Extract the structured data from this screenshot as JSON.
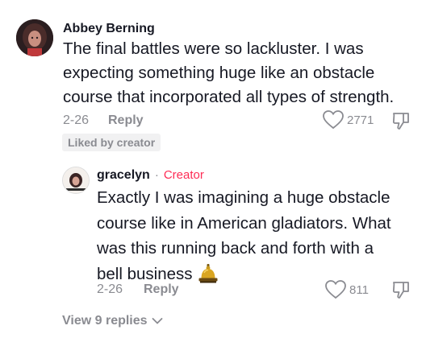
{
  "comment": {
    "username": "Abbey Berning",
    "lines": [
      "The final battles were so lackluster. I was",
      "expecting something huge like an obstacle",
      "course that incorporated all types of strength."
    ],
    "date": "2-26",
    "reply_label": "Reply",
    "likes": "2771",
    "liked_badge": "Liked by creator"
  },
  "reply": {
    "username": "gracelyn",
    "separator": "·",
    "role": "Creator",
    "lines": [
      "Exactly I was imagining a huge obstacle",
      "course like in American gladiators. What",
      "was this running back and forth with a",
      "bell business"
    ],
    "emoji": "bell-emoji",
    "date": "2-26",
    "reply_label": "Reply",
    "likes": "811"
  },
  "view_replies": "View 9 replies",
  "colors": {
    "text": "#161823",
    "muted": "#8a8b91",
    "creator": "#fe2c55",
    "badge_bg": "#f1f1f2"
  }
}
